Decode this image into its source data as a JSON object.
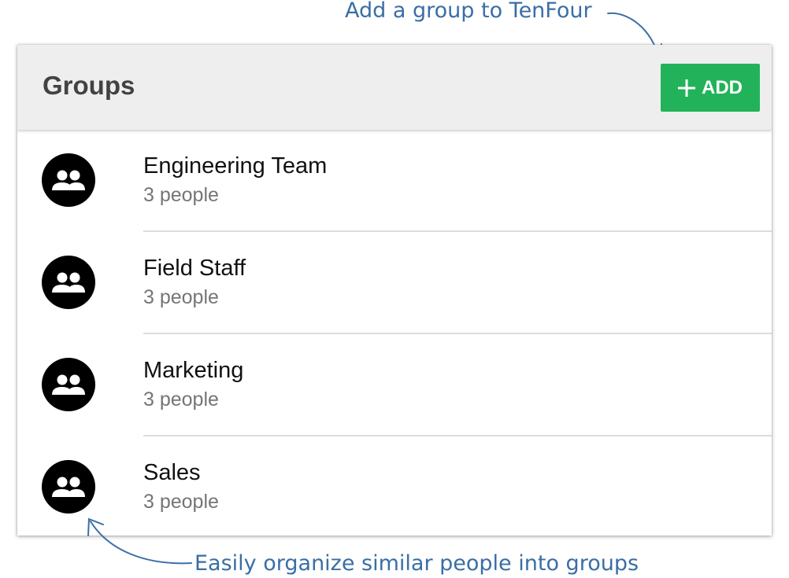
{
  "annotations": {
    "top": "Add a group to TenFour",
    "bottom": "Easily organize similar people into groups"
  },
  "panel": {
    "title": "Groups",
    "add_button_label": "ADD",
    "add_button_icon": "plus-icon",
    "accent_color": "#22b35a"
  },
  "groups": [
    {
      "name": "Engineering Team",
      "count": "3 people",
      "icon": "group-icon"
    },
    {
      "name": "Field Staff",
      "count": "3 people",
      "icon": "group-icon"
    },
    {
      "name": "Marketing",
      "count": "3 people",
      "icon": "group-icon"
    },
    {
      "name": "Sales",
      "count": "3 people",
      "icon": "group-icon"
    }
  ]
}
